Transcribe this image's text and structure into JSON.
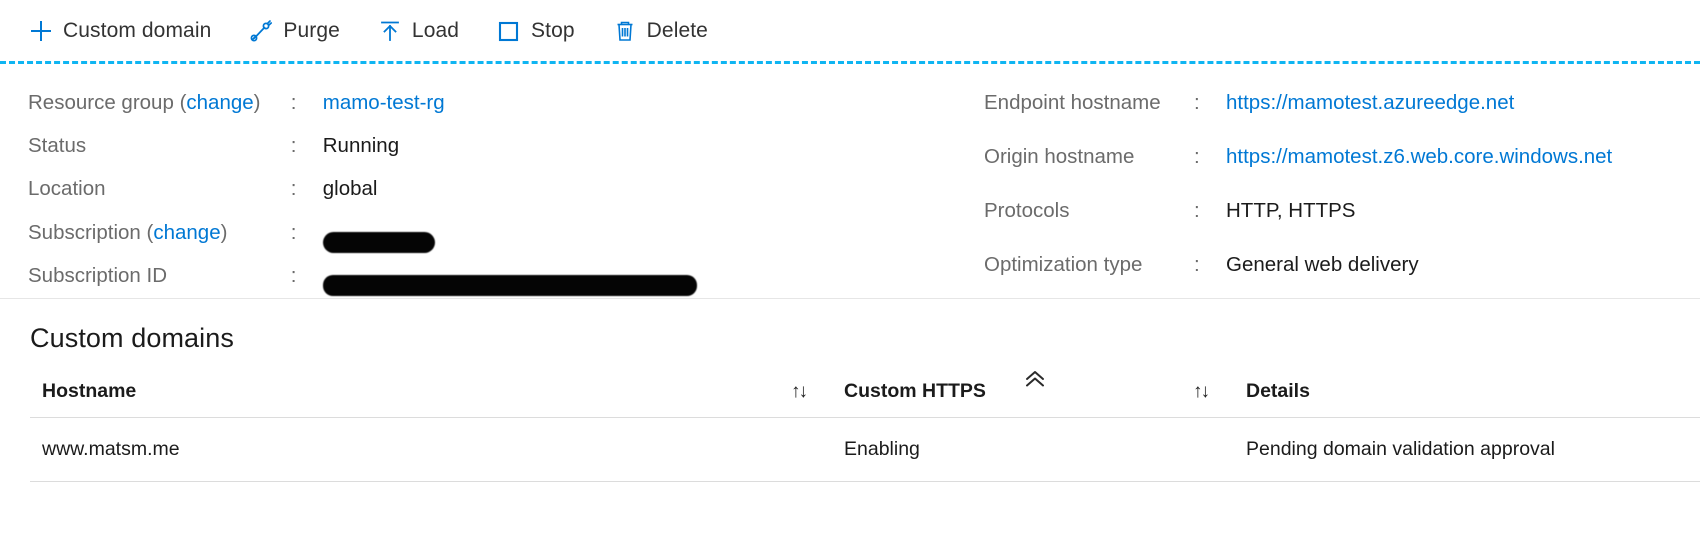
{
  "colors": {
    "accent": "#0078d4",
    "dashed_rule": "#0fb5f2",
    "text": "#1b1b1b",
    "muted": "#6b6b6b"
  },
  "toolbar": {
    "items": [
      {
        "label": "Custom domain",
        "icon": "plus-icon"
      },
      {
        "label": "Purge",
        "icon": "purge-icon"
      },
      {
        "label": "Load",
        "icon": "load-icon"
      },
      {
        "label": "Stop",
        "icon": "stop-icon"
      },
      {
        "label": "Delete",
        "icon": "delete-icon"
      }
    ]
  },
  "essentials": {
    "left": [
      {
        "key": "Resource group",
        "change": "change",
        "sep": ":",
        "value": "mamo-test-rg",
        "link": true
      },
      {
        "key": "Status",
        "sep": ":",
        "value": "Running",
        "link": false
      },
      {
        "key": "Location",
        "sep": ":",
        "value": "global",
        "link": false
      },
      {
        "key": "Subscription",
        "change": "change",
        "sep": ":",
        "value": "",
        "redacted": "short"
      },
      {
        "key": "Subscription ID",
        "sep": ":",
        "value": "",
        "redacted": "long"
      }
    ],
    "right": [
      {
        "key": "Endpoint hostname",
        "sep": ":",
        "value": "https://mamotest.azureedge.net",
        "link": true
      },
      {
        "key": "Origin hostname",
        "sep": ":",
        "value": "https://mamotest.z6.web.core.windows.net",
        "link": true
      },
      {
        "key": "Protocols",
        "sep": ":",
        "value": "HTTP, HTTPS",
        "link": false
      },
      {
        "key": "Optimization type",
        "sep": ":",
        "value": "General web delivery",
        "link": false
      }
    ],
    "collapse_icon": "chevron-double-up-icon"
  },
  "custom_domains": {
    "title": "Custom domains",
    "sort_glyph": "↑↓",
    "columns": [
      {
        "label": "Hostname",
        "sortable": true
      },
      {
        "label": "Custom HTTPS",
        "sortable": true
      },
      {
        "label": "Details",
        "sortable": false
      }
    ],
    "rows": [
      {
        "hostname": "www.matsm.me",
        "custom_https": "Enabling",
        "details": "Pending domain validation approval"
      }
    ]
  }
}
